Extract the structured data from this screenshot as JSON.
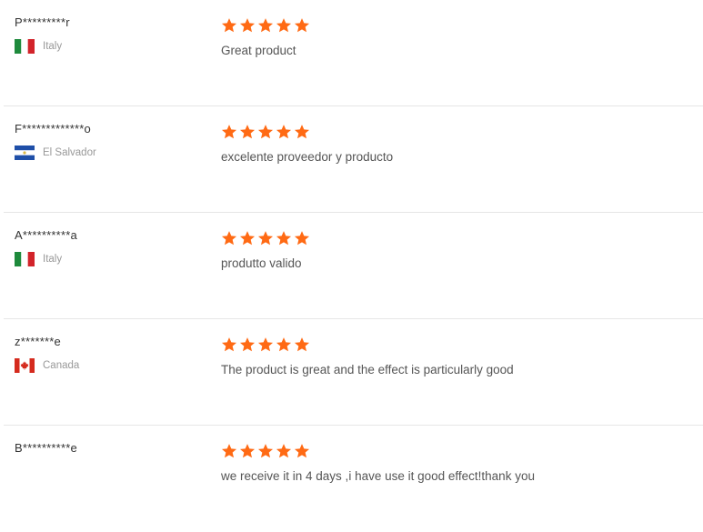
{
  "colors": {
    "star": "#ff6a14",
    "divider": "#e6e6e6",
    "buyer_text": "#333333",
    "country_text": "#999999",
    "comment_text": "#555555"
  },
  "reviews": [
    {
      "buyer": "P*********r",
      "country": "Italy",
      "flag": "italy-flag-icon",
      "rating": 5,
      "comment": "Great product"
    },
    {
      "buyer": "F*************o",
      "country": "El Salvador",
      "flag": "el-salvador-flag-icon",
      "rating": 5,
      "comment": "excelente proveedor y producto"
    },
    {
      "buyer": "A**********a",
      "country": "Italy",
      "flag": "italy-flag-icon",
      "rating": 5,
      "comment": "produtto valido"
    },
    {
      "buyer": "z*******e",
      "country": "Canada",
      "flag": "canada-flag-icon",
      "rating": 5,
      "comment": "The product is great and the effect is particularly good"
    },
    {
      "buyer": "B**********e",
      "country": "",
      "flag": "",
      "rating": 5,
      "comment": "we receive it in 4 days ,i have use it good effect!thank you"
    }
  ]
}
